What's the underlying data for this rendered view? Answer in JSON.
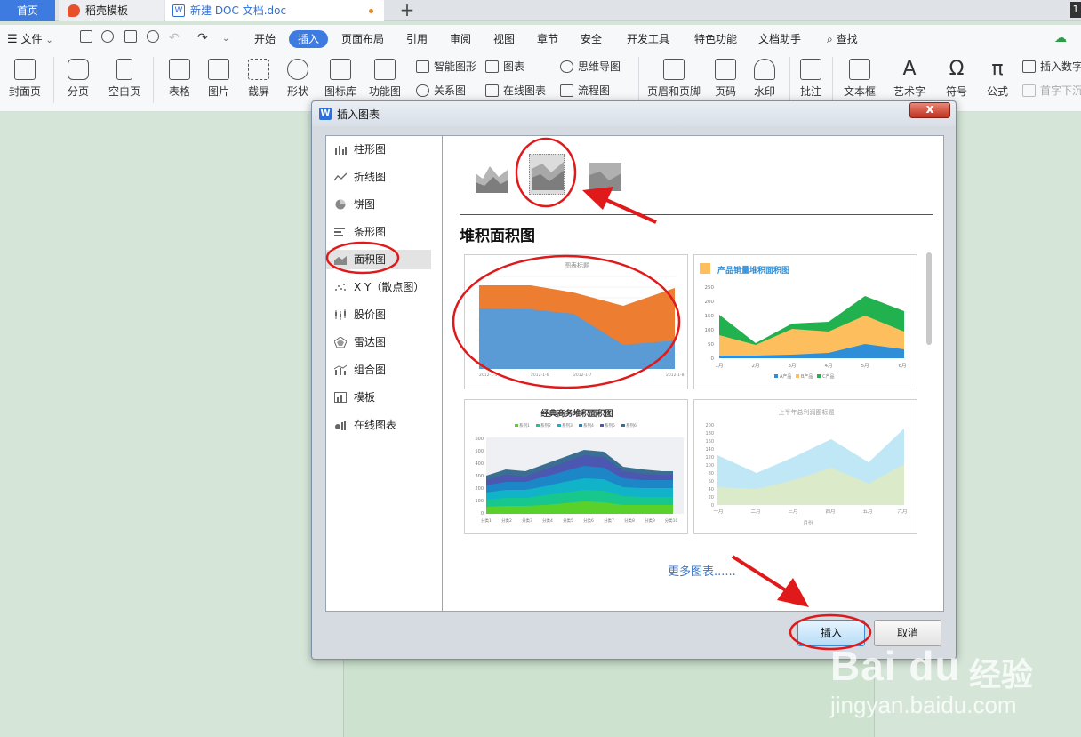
{
  "tabs": {
    "home": "首页",
    "docer": "稻壳模板",
    "doc": "新建 DOC 文档.doc",
    "doc_icon": "W",
    "count": "1"
  },
  "menu": {
    "file": "文件",
    "items": [
      "开始",
      "插入",
      "页面布局",
      "引用",
      "审阅",
      "视图",
      "章节",
      "安全",
      "开发工具",
      "特色功能",
      "文档助手"
    ],
    "active": "插入",
    "search": "查找"
  },
  "ribbon": {
    "cover": "封面页",
    "pagebreak": "分页",
    "blankpage": "空白页",
    "table": "表格",
    "picture": "图片",
    "screenshot": "截屏",
    "shape": "形状",
    "iconlib": "图标库",
    "funcchart": "功能图",
    "smartart": "智能图形",
    "chart": "图表",
    "mindmap": "思维导图",
    "relation": "关系图",
    "onlinechart": "在线图表",
    "flowchart": "流程图",
    "headerfooter": "页眉和页脚",
    "pagenum": "页码",
    "watermark": "水印",
    "comment": "批注",
    "textbox": "文本框",
    "wordart": "艺术字",
    "symbol": "符号",
    "formula": "公式",
    "insertnum": "插入数字",
    "dropcap": "首字下沉"
  },
  "dialog": {
    "logo": "W",
    "title": "插入图表",
    "close": "x",
    "categories": [
      "柱形图",
      "折线图",
      "饼图",
      "条形图",
      "面积图",
      "X Y（散点图）",
      "股价图",
      "雷达图",
      "组合图",
      "模板",
      "在线图表"
    ],
    "selected_category": "面积图",
    "section_title": "堆积面积图",
    "more_link": "更多图表......",
    "insert_button": "插入",
    "cancel_button": "取消"
  },
  "previews": [
    {
      "title": "图表标题",
      "x_labels": [
        "2012-1-5",
        "2012-1-6",
        "2012-1-7",
        "2012-1-8"
      ],
      "colors": [
        "#5b9bd5",
        "#ed7d31"
      ]
    },
    {
      "title": "产品销量堆积面积图",
      "y_ticks": [
        "250",
        "200",
        "150",
        "100",
        "50",
        "0"
      ],
      "x_labels": [
        "1月",
        "2月",
        "3月",
        "4月",
        "5月",
        "6月"
      ],
      "legend": [
        "A产品",
        "B产品",
        "C产品"
      ],
      "colors": [
        "#2e8fd8",
        "#fdbf5e",
        "#21b14f"
      ]
    },
    {
      "title": "经典商务堆积面积图",
      "legend": [
        "系列1",
        "系列2",
        "系列3",
        "系列4",
        "系列5",
        "系列6"
      ],
      "y_ticks": [
        "600",
        "500",
        "400",
        "300",
        "200",
        "100",
        "0"
      ],
      "x_labels": [
        "分类1",
        "分类2",
        "分类3",
        "分类4",
        "分类5",
        "分类6",
        "分类7",
        "分类8",
        "分类9",
        "分类10"
      ],
      "colors": [
        "#5ad12a",
        "#17c78e",
        "#10b3c8",
        "#1d86c7",
        "#4b57b1",
        "#3a6f93"
      ]
    },
    {
      "title": "上半年总利润图标题",
      "y_ticks": [
        "200",
        "180",
        "160",
        "140",
        "120",
        "100",
        "80",
        "60",
        "40",
        "20",
        "0"
      ],
      "x_labels": [
        "一月",
        "二月",
        "三月",
        "四月",
        "五月",
        "六月"
      ],
      "xlabel": "月份",
      "colors": [
        "#b8e4f5",
        "#dcebc6"
      ]
    }
  ],
  "watermark": {
    "brand": "Bai du",
    "text": "经验",
    "url": "jingyan.baidu.com"
  },
  "colors": {
    "accent": "#3d7be0",
    "annotation": "#e0191b",
    "link": "#3b78c9"
  }
}
